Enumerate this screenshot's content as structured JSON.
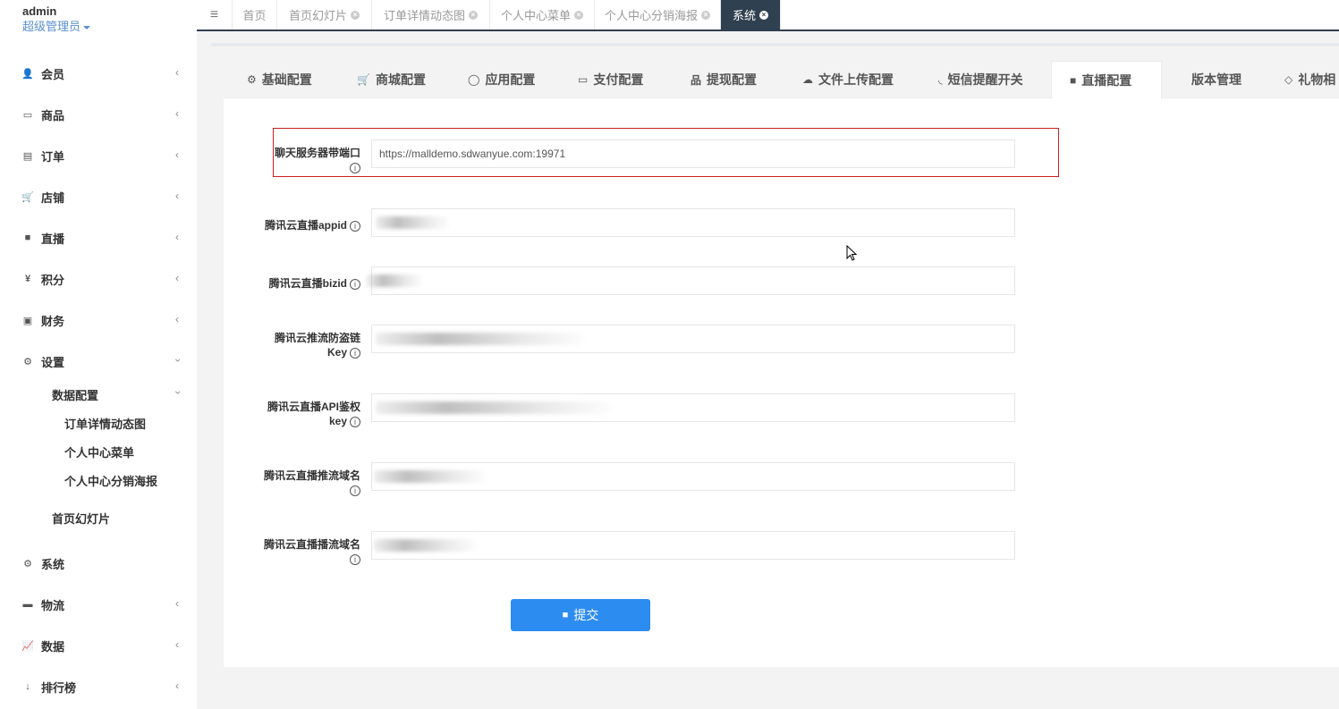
{
  "user": {
    "name": "admin",
    "role": "超级管理员"
  },
  "nav": [
    {
      "label": "会员",
      "icon": "user-icon",
      "glyph": "👤"
    },
    {
      "label": "商品",
      "icon": "laptop-icon",
      "glyph": "▭"
    },
    {
      "label": "订单",
      "icon": "document-icon",
      "glyph": "▤"
    },
    {
      "label": "店铺",
      "icon": "cart-icon",
      "glyph": "🛒"
    },
    {
      "label": "直播",
      "icon": "video-icon",
      "glyph": "■"
    },
    {
      "label": "积分",
      "icon": "yen-icon",
      "glyph": "¥"
    },
    {
      "label": "财务",
      "icon": "money-icon",
      "glyph": "▣"
    },
    {
      "label": "设置",
      "icon": "gear-icon",
      "glyph": "⚙"
    },
    {
      "label": "系统",
      "icon": "gears-icon",
      "glyph": "⚙"
    },
    {
      "label": "物流",
      "icon": "truck-icon",
      "glyph": "▬"
    },
    {
      "label": "数据",
      "icon": "line-chart-icon",
      "glyph": "📈"
    },
    {
      "label": "排行榜",
      "icon": "sort-icon",
      "glyph": "↓"
    }
  ],
  "settings_sub": {
    "data_config": "数据配置",
    "children": [
      "订单详情动态图",
      "个人中心菜单",
      "个人中心分销海报"
    ],
    "home_slides": "首页幻灯片"
  },
  "top_tabs": [
    {
      "label": "首页",
      "closable": false
    },
    {
      "label": "首页幻灯片",
      "closable": true
    },
    {
      "label": "订单详情动态图",
      "closable": true
    },
    {
      "label": "个人中心菜单",
      "closable": true
    },
    {
      "label": "个人中心分销海报",
      "closable": true
    },
    {
      "label": "系统",
      "closable": true,
      "active": true
    }
  ],
  "config_tabs": [
    {
      "label": "基础配置",
      "icon": "gear-icon",
      "glyph": "⚙"
    },
    {
      "label": "商城配置",
      "icon": "cart-icon",
      "glyph": "🛒"
    },
    {
      "label": "应用配置",
      "icon": "whatsapp-icon",
      "glyph": "◯"
    },
    {
      "label": "支付配置",
      "icon": "credit-card-icon",
      "glyph": "▭"
    },
    {
      "label": "提现配置",
      "icon": "sitemap-icon",
      "glyph": "品"
    },
    {
      "label": "文件上传配置",
      "icon": "cloud-upload-icon",
      "glyph": "☁"
    },
    {
      "label": "短信提醒开关",
      "icon": "rss-icon",
      "glyph": "◟"
    },
    {
      "label": "直播配置",
      "icon": "video-icon",
      "glyph": "■",
      "active": true
    },
    {
      "label": "版本管理",
      "icon": "",
      "glyph": ""
    },
    {
      "label": "礼物相",
      "icon": "diamond-icon",
      "glyph": "◇"
    }
  ],
  "form": {
    "chat_server": {
      "label_line1": "聊天服务器带端口",
      "value": "https://malldemo.sdwanyue.com:19971"
    },
    "appid": {
      "label": "腾讯云直播appid"
    },
    "bizid": {
      "label": "腾讯云直播bizid"
    },
    "push_key": {
      "label_line1": "腾讯云推流防盗链",
      "label_line2": "Key"
    },
    "api_key": {
      "label_line1": "腾讯云直播API鉴权",
      "label_line2": "key"
    },
    "push_domain": {
      "label": "腾讯云直播推流域名"
    },
    "play_domain": {
      "label": "腾讯云直播播流域名"
    },
    "info_glyph": "i"
  },
  "submit": {
    "label": "提交"
  },
  "colors": {
    "sidebar_dark": "#2f4050",
    "accent": "#2d8cf0",
    "highlight": "#cc1f1f",
    "link": "#5a8fd0"
  }
}
